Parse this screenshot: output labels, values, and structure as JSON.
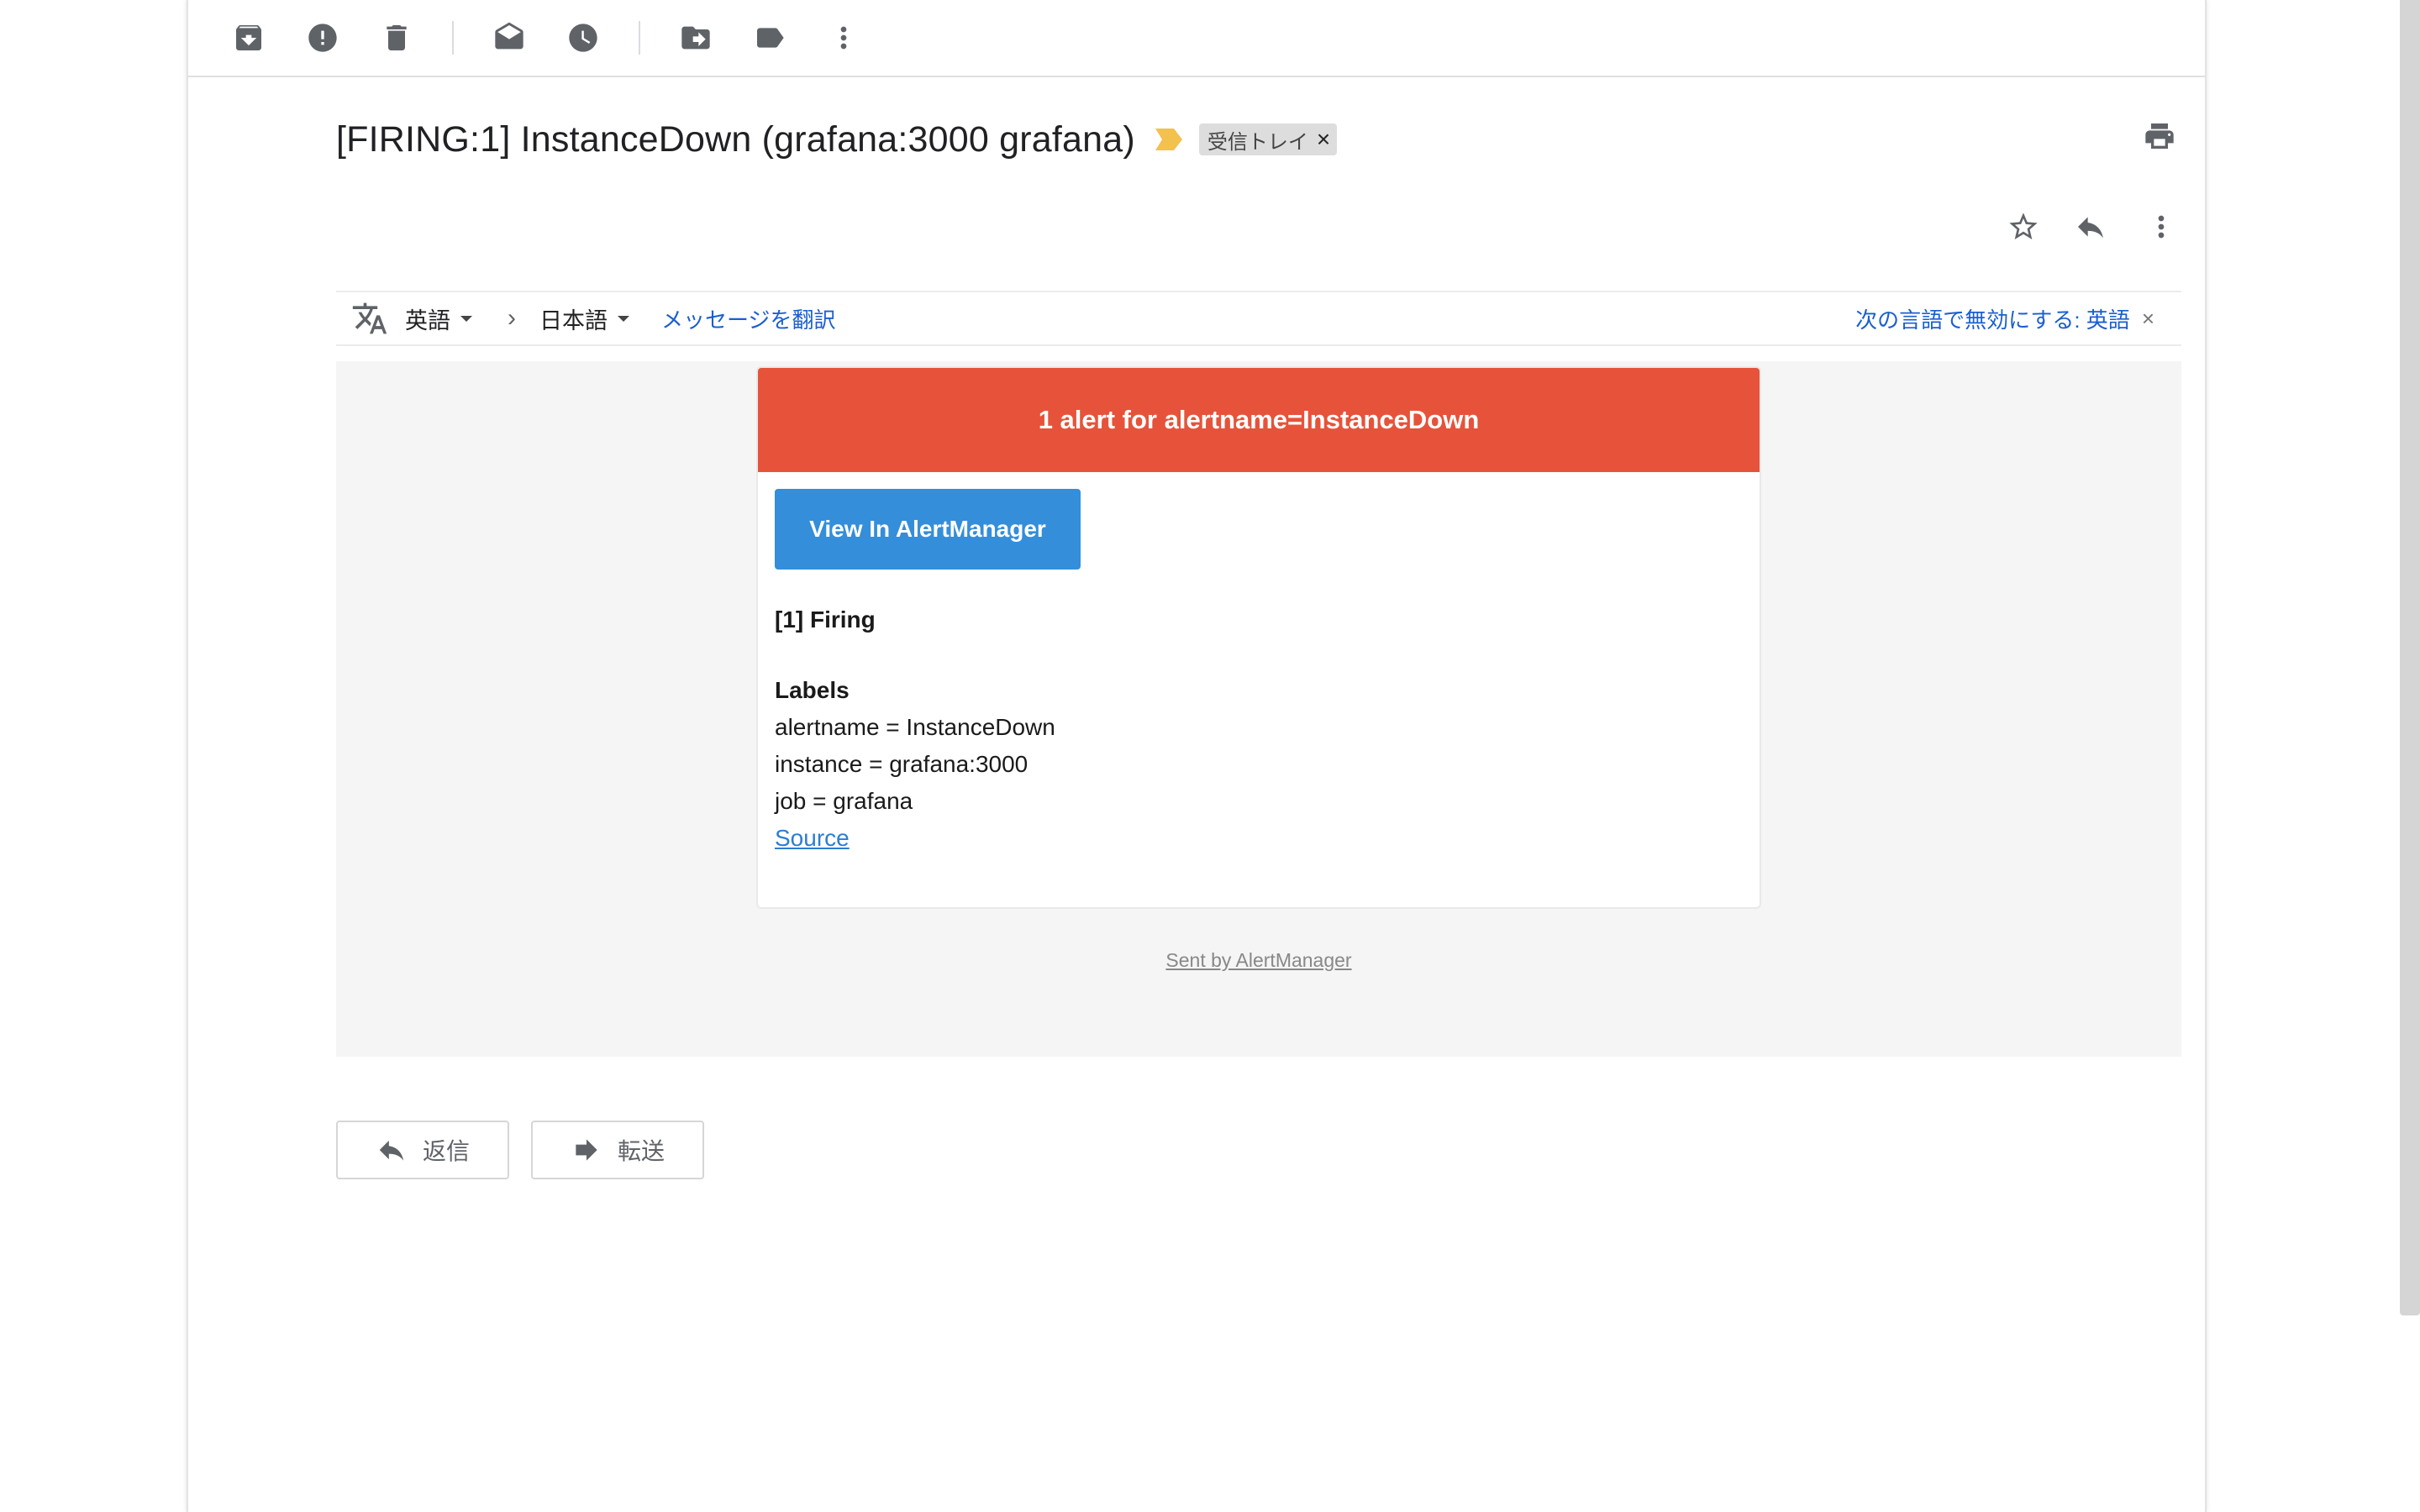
{
  "toolbar": {
    "buttons": [
      "archive",
      "report-spam",
      "delete",
      "mark-unread",
      "snooze",
      "move-to",
      "label",
      "more"
    ]
  },
  "subject": {
    "title": "[FIRING:1] InstanceDown (grafana:3000 grafana)",
    "label_chip": "受信トレイ",
    "chip_close": "×"
  },
  "translate": {
    "source_lang": "英語",
    "arrow": "›",
    "target_lang": "日本語",
    "translate_link": "メッセージを翻訳",
    "disable_text": "次の言語で無効にする: 英語",
    "close": "×"
  },
  "email": {
    "header": "1 alert for alertname=InstanceDown",
    "button": "View In AlertManager",
    "firing": "[1] Firing",
    "labels_title": "Labels",
    "labels": [
      "alertname = InstanceDown",
      "instance = grafana:3000",
      "job = grafana"
    ],
    "source": "Source",
    "footer": "Sent by AlertManager"
  },
  "actions": {
    "reply": "返信",
    "forward": "転送"
  },
  "colors": {
    "alert_header": "#e6533a",
    "button": "#348eda",
    "link": "#1a5fd0",
    "importance": "#f2c14e"
  }
}
